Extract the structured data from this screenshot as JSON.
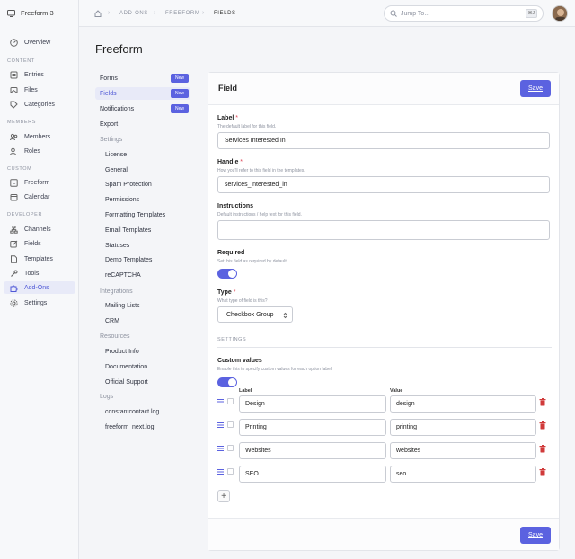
{
  "app": {
    "title": "Freeform 3"
  },
  "sidebar": {
    "sections": {
      "content": "CONTENT",
      "members": "MEMBERS",
      "custom": "CUSTOM",
      "developer": "DEVELOPER"
    },
    "items": {
      "overview": "Overview",
      "entries": "Entries",
      "files": "Files",
      "categories": "Categories",
      "members": "Members",
      "roles": "Roles",
      "freeform": "Freeform",
      "calendar": "Calendar",
      "channels": "Channels",
      "fields": "Fields",
      "templates": "Templates",
      "tools": "Tools",
      "addons": "Add-Ons",
      "settings": "Settings"
    }
  },
  "breadcrumb": {
    "addons": "ADD-ONS",
    "freeform": "FREEFORM",
    "fields": "FIELDS"
  },
  "search": {
    "placeholder": "Jump To...",
    "shortcut": "⌘J"
  },
  "page": {
    "title": "Freeform"
  },
  "subnav": {
    "forms": "Forms",
    "fields": "Fields",
    "notifications": "Notifications",
    "new_badge": "New",
    "export": "Export",
    "settings": "Settings",
    "license": "License",
    "general": "General",
    "spam": "Spam Protection",
    "permissions": "Permissions",
    "formatting": "Formatting Templates",
    "email_templates": "Email Templates",
    "statuses": "Statuses",
    "demo": "Demo Templates",
    "recaptcha": "reCAPTCHA",
    "integrations": "Integrations",
    "mailing": "Mailing Lists",
    "crm": "CRM",
    "resources": "Resources",
    "product_info": "Product Info",
    "documentation": "Documentation",
    "support": "Official Support",
    "logs": "Logs",
    "log1": "constantcontact.log",
    "log2": "freeform_next.log"
  },
  "card": {
    "title": "Field",
    "save": "Save",
    "label": {
      "title": "Label",
      "hint": "The default label for this field.",
      "value": "Services Interested In"
    },
    "handle": {
      "title": "Handle",
      "hint": "How you'll refer to this field in the templates.",
      "value": "services_interested_in"
    },
    "instructions": {
      "title": "Instructions",
      "hint": "Default instructions / help text for this field.",
      "value": ""
    },
    "required": {
      "title": "Required",
      "hint": "Set this field as required by default."
    },
    "type": {
      "title": "Type",
      "hint": "What type of field is this?",
      "value": "Checkbox Group"
    },
    "settings_heading": "SETTINGS",
    "custom_values": {
      "title": "Custom values",
      "hint": "Enable this to specify custom values for each option label."
    },
    "table": {
      "col_label": "Label",
      "col_value": "Value",
      "rows": [
        {
          "label": "Design",
          "value": "design"
        },
        {
          "label": "Printing",
          "value": "printing"
        },
        {
          "label": "Websites",
          "value": "websites"
        },
        {
          "label": "SEO",
          "value": "seo"
        }
      ]
    }
  },
  "colors": {
    "accent": "#5b62e0",
    "danger": "#d03a3a"
  }
}
